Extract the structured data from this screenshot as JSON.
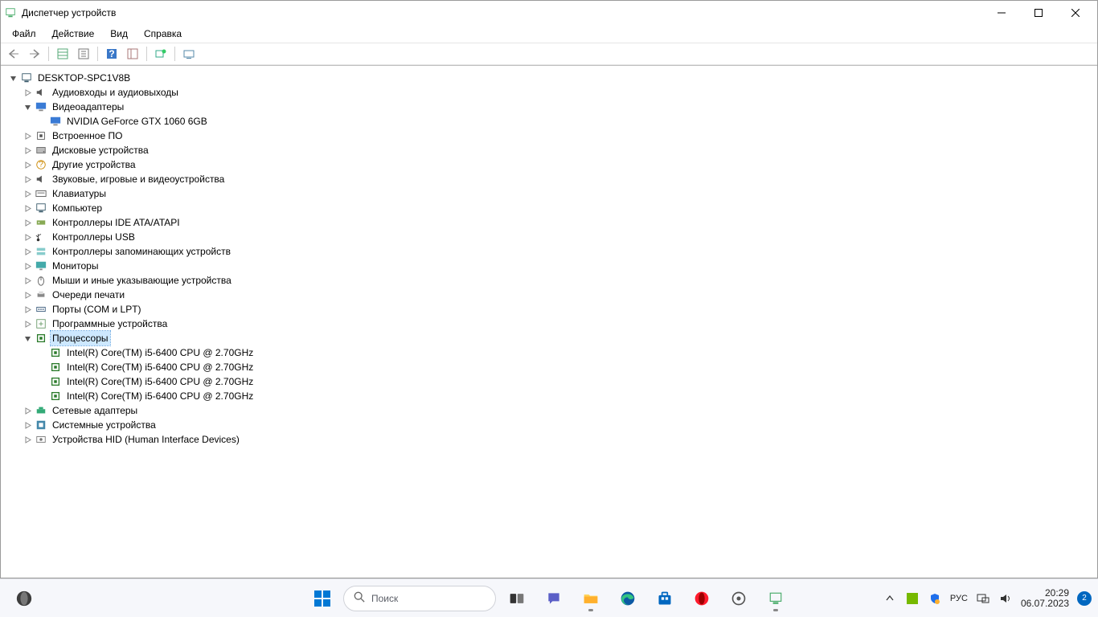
{
  "titlebar": {
    "title": "Диспетчер устройств"
  },
  "menu": {
    "file": "Файл",
    "action": "Действие",
    "view": "Вид",
    "help": "Справка"
  },
  "tree": {
    "root": "DESKTOP-SPC1V8B",
    "nodes": [
      {
        "label": "Аудиовходы и аудиовыходы",
        "icon": "audio",
        "expanded": false
      },
      {
        "label": "Видеоадаптеры",
        "icon": "display",
        "expanded": true,
        "children": [
          {
            "label": "NVIDIA GeForce GTX 1060 6GB",
            "icon": "display"
          }
        ]
      },
      {
        "label": "Встроенное ПО",
        "icon": "chip",
        "expanded": false
      },
      {
        "label": "Дисковые устройства",
        "icon": "disk",
        "expanded": false
      },
      {
        "label": "Другие устройства",
        "icon": "unknown",
        "expanded": false
      },
      {
        "label": "Звуковые, игровые и видеоустройства",
        "icon": "audio",
        "expanded": false
      },
      {
        "label": "Клавиатуры",
        "icon": "keyboard",
        "expanded": false
      },
      {
        "label": "Компьютер",
        "icon": "computer",
        "expanded": false
      },
      {
        "label": "Контроллеры IDE ATA/ATAPI",
        "icon": "ide",
        "expanded": false
      },
      {
        "label": "Контроллеры USB",
        "icon": "usb",
        "expanded": false
      },
      {
        "label": "Контроллеры запоминающих устройств",
        "icon": "storage",
        "expanded": false
      },
      {
        "label": "Мониторы",
        "icon": "monitor",
        "expanded": false
      },
      {
        "label": "Мыши и иные указывающие устройства",
        "icon": "mouse",
        "expanded": false
      },
      {
        "label": "Очереди печати",
        "icon": "printer",
        "expanded": false
      },
      {
        "label": "Порты (COM и LPT)",
        "icon": "port",
        "expanded": false
      },
      {
        "label": "Программные устройства",
        "icon": "software",
        "expanded": false
      },
      {
        "label": "Процессоры",
        "icon": "cpu",
        "expanded": true,
        "selected": true,
        "children": [
          {
            "label": "Intel(R) Core(TM) i5-6400 CPU @ 2.70GHz",
            "icon": "cpu"
          },
          {
            "label": "Intel(R) Core(TM) i5-6400 CPU @ 2.70GHz",
            "icon": "cpu"
          },
          {
            "label": "Intel(R) Core(TM) i5-6400 CPU @ 2.70GHz",
            "icon": "cpu"
          },
          {
            "label": "Intel(R) Core(TM) i5-6400 CPU @ 2.70GHz",
            "icon": "cpu"
          }
        ]
      },
      {
        "label": "Сетевые адаптеры",
        "icon": "network",
        "expanded": false
      },
      {
        "label": "Системные устройства",
        "icon": "system",
        "expanded": false
      },
      {
        "label": "Устройства HID (Human Interface Devices)",
        "icon": "hid",
        "expanded": false
      }
    ]
  },
  "taskbar": {
    "search_placeholder": "Поиск",
    "lang": "РУС",
    "time": "20:29",
    "date": "06.07.2023",
    "notifications": "2"
  }
}
